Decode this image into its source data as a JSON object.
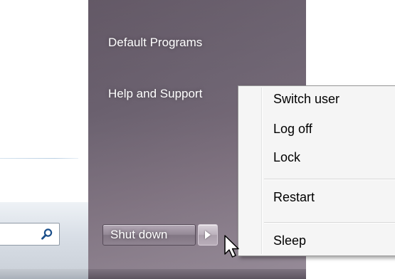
{
  "start_menu": {
    "right_pane": {
      "items": [
        {
          "label": "Default Programs"
        },
        {
          "label": "Help and Support"
        }
      ]
    },
    "shutdown": {
      "label": "Shut down",
      "arrow_icon": "chevron-right-icon"
    },
    "search": {
      "icon": "search-icon"
    }
  },
  "context_menu": {
    "items": [
      {
        "label": "Switch user"
      },
      {
        "label": "Log off"
      },
      {
        "label": "Lock"
      },
      {
        "label": "Restart"
      },
      {
        "label": "Sleep"
      }
    ]
  },
  "colors": {
    "panel": "#6c6270",
    "menu_background": "#f5f5f5",
    "menu_text": "#000000",
    "panel_text": "#ffffff"
  }
}
